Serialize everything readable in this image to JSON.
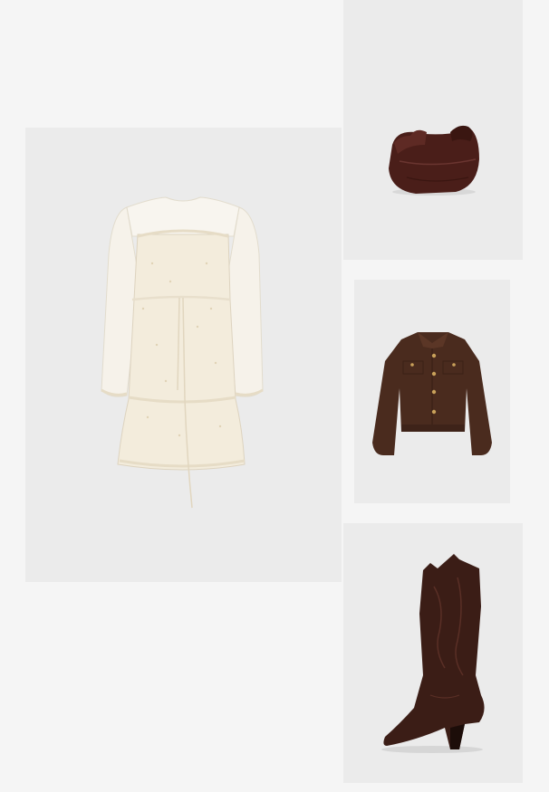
{
  "page": {
    "background": "#f5f5f5",
    "panel_color": "#ebebeb"
  },
  "items": [
    {
      "id": "dress",
      "icon": "cream-tiered-dress",
      "color": "#f3ecdc"
    },
    {
      "id": "bag",
      "icon": "brown-hobo-bag",
      "color": "#4a1e19"
    },
    {
      "id": "jacket",
      "icon": "brown-corduroy-jacket",
      "color": "#4a2b1e"
    },
    {
      "id": "boot",
      "icon": "brown-cowboy-boot",
      "color": "#3b1d16"
    }
  ]
}
